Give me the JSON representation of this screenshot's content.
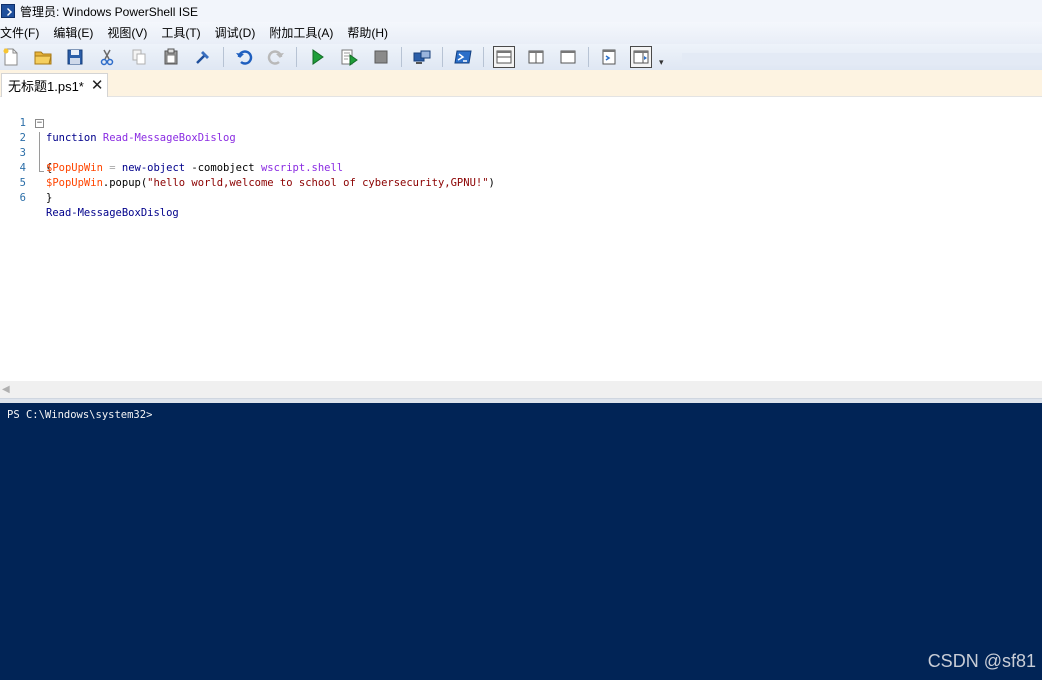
{
  "window": {
    "title": "管理员: Windows PowerShell ISE"
  },
  "menu": {
    "items": [
      "文件(F)",
      "编辑(E)",
      "视图(V)",
      "工具(T)",
      "调试(D)",
      "附加工具(A)",
      "帮助(H)"
    ]
  },
  "toolbar": {
    "icons": [
      "new-file-icon",
      "open-folder-icon",
      "save-icon",
      "cut-icon",
      "copy-icon",
      "paste-icon",
      "clear-icon",
      "undo-icon",
      "redo-icon",
      "run-icon",
      "run-selection-icon",
      "stop-icon",
      "remote-powershell-icon",
      "powershell-console-icon",
      "layout-top-icon",
      "layout-right-icon",
      "layout-max-icon",
      "show-command-icon",
      "show-addon-icon"
    ],
    "overflow": "▾"
  },
  "tabs": [
    {
      "label": "无标题1.ps1*",
      "close": "✕"
    }
  ],
  "editor": {
    "line_numbers": [
      "1",
      "2",
      "3",
      "4",
      "5",
      "6"
    ],
    "lines": [
      {
        "tokens": [
          {
            "t": "function",
            "c": "kw"
          },
          {
            "t": " ",
            "c": "dflt"
          },
          {
            "t": "Read-MessageBoxDislog",
            "c": "fn"
          }
        ]
      },
      {
        "tokens": [
          {
            "t": "{",
            "c": "dflt"
          }
        ]
      },
      {
        "tokens": [
          {
            "t": "$PopUpWin",
            "c": "var"
          },
          {
            "t": " = ",
            "c": "op"
          },
          {
            "t": "new-object",
            "c": "kw"
          },
          {
            "t": " -comobject ",
            "c": "dflt"
          },
          {
            "t": "wscript.shell",
            "c": "fn"
          }
        ]
      },
      {
        "tokens": [
          {
            "t": "$PopUpWin",
            "c": "var"
          },
          {
            "t": ".popup(",
            "c": "dflt"
          },
          {
            "t": "\"hello world,welcome to school of cybersecurity,GPNU!\"",
            "c": "str"
          },
          {
            "t": ")",
            "c": "dflt"
          }
        ]
      },
      {
        "tokens": [
          {
            "t": "}",
            "c": "dflt"
          }
        ]
      },
      {
        "tokens": [
          {
            "t": "Read-MessageBoxDislog",
            "c": "kw"
          }
        ]
      }
    ]
  },
  "console": {
    "prompt": "PS C:\\Windows\\system32>"
  },
  "watermark": "CSDN @sf81",
  "colors": {
    "console_bg": "#012456",
    "keyword": "#00008b",
    "function": "#8a2be2",
    "variable": "#ff4500",
    "string": "#8b0000"
  }
}
